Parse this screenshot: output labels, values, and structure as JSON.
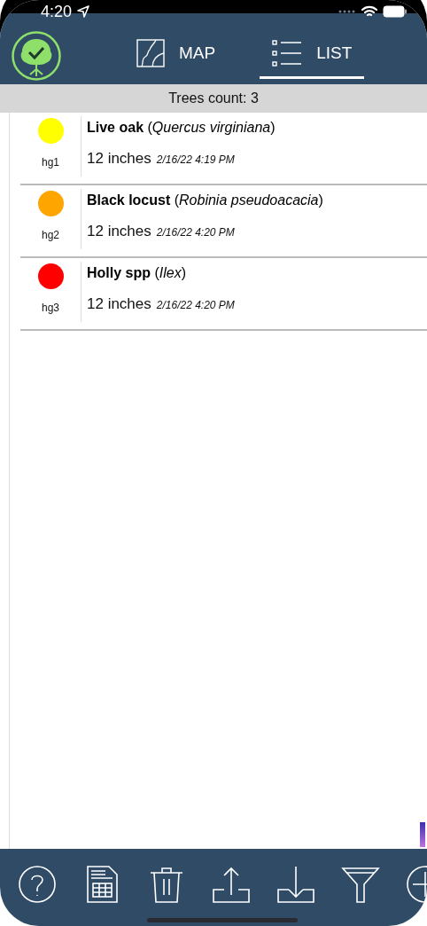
{
  "status_bar": {
    "time": "4:20"
  },
  "tabs": [
    {
      "label": "MAP",
      "kind": "map",
      "selected": false
    },
    {
      "label": "LIST",
      "kind": "list",
      "selected": true
    }
  ],
  "header": {
    "title": "Trees count: 3"
  },
  "trees": [
    {
      "color": "#ffff00",
      "code": "hg1",
      "title": "**Live oak** (*Quercus virginiana*)",
      "size": "12 inches",
      "date": "2/16/22 4:19 PM"
    },
    {
      "color": "#ffa500",
      "code": "hg2",
      "title": "**Black locust** (*Robinia pseudoacacia*)",
      "size": "12 inches",
      "date": "2/16/22 4:20 PM"
    },
    {
      "color": "#ff0000",
      "code": "hg3",
      "title": "**Holly spp** (*Ilex*)",
      "size": "12 inches",
      "date": "2/16/22 4:20 PM"
    }
  ],
  "toolbar": [
    {
      "kind": "help"
    },
    {
      "kind": "spreadsheet"
    },
    {
      "kind": "trash"
    },
    {
      "kind": "upload"
    },
    {
      "kind": "download"
    },
    {
      "kind": "filter"
    },
    {
      "kind": "add"
    }
  ]
}
